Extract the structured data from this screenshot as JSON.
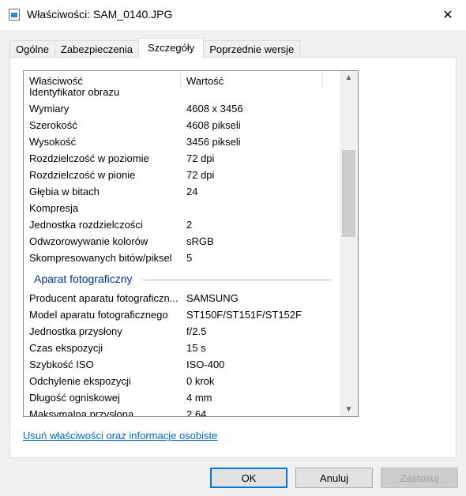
{
  "window": {
    "title": "Właściwości: SAM_0140.JPG",
    "icon": "image-file-icon",
    "close_label": "✕"
  },
  "tabs": [
    {
      "label": "Ogólne",
      "active": false
    },
    {
      "label": "Zabezpieczenia",
      "active": false
    },
    {
      "label": "Szczegóły",
      "active": true
    },
    {
      "label": "Poprzednie wersje",
      "active": false
    }
  ],
  "list": {
    "col_property": "Właściwość",
    "col_value": "Wartość",
    "clipped_row_top": "Identyfikator obrazu",
    "image_rows": [
      {
        "k": "Wymiary",
        "v": "4608 x 3456"
      },
      {
        "k": "Szerokość",
        "v": "4608 pikseli"
      },
      {
        "k": "Wysokość",
        "v": "3456 pikseli"
      },
      {
        "k": "Rozdzielczość w poziomie",
        "v": "72 dpi"
      },
      {
        "k": "Rozdzielczość w pionie",
        "v": "72 dpi"
      },
      {
        "k": "Głębia w bitach",
        "v": "24"
      },
      {
        "k": "Kompresja",
        "v": ""
      },
      {
        "k": "Jednostka rozdzielczości",
        "v": "2"
      },
      {
        "k": "Odwzorowywanie kolorów",
        "v": "sRGB"
      },
      {
        "k": "Skompresowanych bitów/piksel",
        "v": "5"
      }
    ],
    "section_camera": "Aparat fotograficzny",
    "camera_rows": [
      {
        "k": "Producent aparatu fotograficzn...",
        "v": "SAMSUNG"
      },
      {
        "k": "Model aparatu fotograficznego",
        "v": "ST150F/ST151F/ST152F"
      },
      {
        "k": "Jednostka przysłony",
        "v": "f/2.5"
      },
      {
        "k": "Czas ekspozycji",
        "v": "15 s"
      },
      {
        "k": "Szybkość ISO",
        "v": "ISO-400"
      },
      {
        "k": "Odchylenie ekspozycji",
        "v": "0 krok"
      },
      {
        "k": "Długość ogniskowej",
        "v": "4 mm"
      },
      {
        "k": "Maksymalna przysłona",
        "v": "2.64"
      }
    ]
  },
  "remove_link": "Usuń właściwości oraz informacje osobiste",
  "buttons": {
    "ok": "OK",
    "cancel": "Anuluj",
    "apply": "Zastosuj"
  }
}
